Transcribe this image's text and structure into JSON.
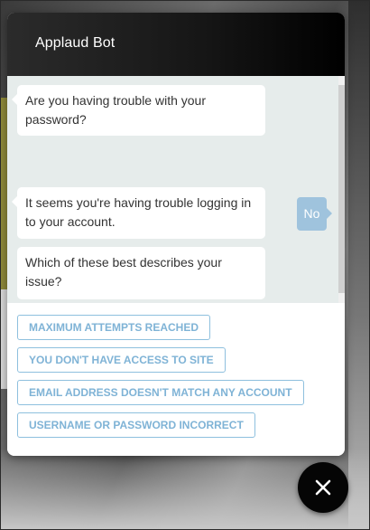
{
  "header": {
    "title": "Applaud Bot"
  },
  "messages": [
    {
      "from": "bot",
      "text": "Are you having trouble with your password?"
    },
    {
      "from": "user",
      "text": "No"
    },
    {
      "from": "bot",
      "text": "It seems you're having trouble logging in to your account."
    },
    {
      "from": "bot",
      "text": "Which of these best describes your issue?"
    }
  ],
  "options": [
    {
      "label": "MAXIMUM ATTEMPTS REACHED"
    },
    {
      "label": "YOU DON'T HAVE ACCESS TO SITE"
    },
    {
      "label": "EMAIL ADDRESS DOESN'T MATCH ANY ACCOUNT"
    },
    {
      "label": "USERNAME OR PASSWORD INCORRECT"
    }
  ],
  "close_button": {
    "icon": "close-icon"
  },
  "colors": {
    "header_bg": "#000000",
    "user_bubble": "#9fc3dd",
    "option_accent": "#7fb3d6",
    "messages_bg": "#e6eceb"
  }
}
